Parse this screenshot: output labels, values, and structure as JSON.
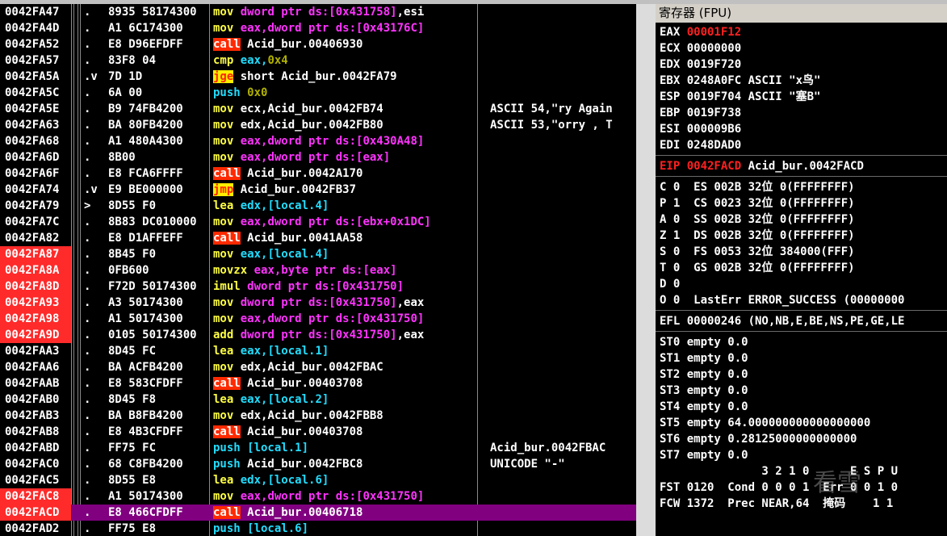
{
  "window": {
    "register_pane_title": "寄存器 (FPU)"
  },
  "disasm_rows": [
    {
      "addr": "0042FA47",
      "bp": false,
      "cur": false,
      "arrow": ".",
      "hex": "8935 58174300",
      "asm": [
        [
          "mov",
          "t-yel"
        ],
        [
          " dword ptr ds:[0x431758]",
          "t-mag"
        ],
        [
          ",esi",
          "t-white"
        ]
      ],
      "cmt": ""
    },
    {
      "addr": "0042FA4D",
      "bp": false,
      "cur": false,
      "arrow": ".",
      "hex": "A1 6C174300",
      "asm": [
        [
          "mov",
          "t-yel"
        ],
        [
          " eax,dword ptr ds:[0x43176C]",
          "t-mag"
        ]
      ],
      "cmt": ""
    },
    {
      "addr": "0042FA52",
      "bp": false,
      "cur": false,
      "arrow": ".",
      "hex": "E8 D96EFDFF",
      "asm": [
        [
          "call",
          "t-call"
        ],
        [
          " Acid_bur.00406930",
          "t-white"
        ]
      ],
      "cmt": ""
    },
    {
      "addr": "0042FA57",
      "bp": false,
      "cur": false,
      "arrow": ".",
      "hex": "83F8 04",
      "asm": [
        [
          "cmp",
          "t-yel"
        ],
        [
          " eax,",
          "t-cyan"
        ],
        [
          "0x4",
          "t-olive"
        ]
      ],
      "cmt": ""
    },
    {
      "addr": "0042FA5A",
      "bp": false,
      "cur": false,
      "arrow": ".v",
      "hex": "7D 1D",
      "asm": [
        [
          "jge",
          "t-jmp"
        ],
        [
          " short Acid_bur.0042FA79",
          "t-white"
        ]
      ],
      "cmt": ""
    },
    {
      "addr": "0042FA5C",
      "bp": false,
      "cur": false,
      "arrow": ".",
      "hex": "6A 00",
      "asm": [
        [
          "push",
          "t-cyan"
        ],
        [
          " 0x0",
          "t-olive"
        ]
      ],
      "cmt": ""
    },
    {
      "addr": "0042FA5E",
      "bp": false,
      "cur": false,
      "arrow": ".",
      "hex": "B9 74FB4200",
      "asm": [
        [
          "mov",
          "t-yel"
        ],
        [
          " ecx,Acid_bur.0042FB74",
          "t-white"
        ]
      ],
      "cmt": "ASCII 54,\"ry Again"
    },
    {
      "addr": "0042FA63",
      "bp": false,
      "cur": false,
      "arrow": ".",
      "hex": "BA 80FB4200",
      "asm": [
        [
          "mov",
          "t-yel"
        ],
        [
          " edx,Acid_bur.0042FB80",
          "t-white"
        ]
      ],
      "cmt": "ASCII 53,\"orry , T"
    },
    {
      "addr": "0042FA68",
      "bp": false,
      "cur": false,
      "arrow": ".",
      "hex": "A1 480A4300",
      "asm": [
        [
          "mov",
          "t-yel"
        ],
        [
          " eax,dword ptr ds:[0x430A48]",
          "t-mag"
        ]
      ],
      "cmt": ""
    },
    {
      "addr": "0042FA6D",
      "bp": false,
      "cur": false,
      "arrow": ".",
      "hex": "8B00",
      "asm": [
        [
          "mov",
          "t-yel"
        ],
        [
          " eax,dword ptr ds:[eax]",
          "t-mag"
        ]
      ],
      "cmt": ""
    },
    {
      "addr": "0042FA6F",
      "bp": false,
      "cur": false,
      "arrow": ".",
      "hex": "E8 FCA6FFFF",
      "asm": [
        [
          "call",
          "t-call"
        ],
        [
          " Acid_bur.0042A170",
          "t-white"
        ]
      ],
      "cmt": ""
    },
    {
      "addr": "0042FA74",
      "bp": false,
      "cur": false,
      "arrow": ".v",
      "hex": "E9 BE000000",
      "asm": [
        [
          "jmp",
          "t-jmp"
        ],
        [
          " Acid_bur.0042FB37",
          "t-white"
        ]
      ],
      "cmt": ""
    },
    {
      "addr": "0042FA79",
      "bp": false,
      "cur": false,
      "arrow": ">",
      "hex": "8D55 F0",
      "asm": [
        [
          "lea",
          "t-yel"
        ],
        [
          " edx,[local.4]",
          "t-cyan"
        ]
      ],
      "cmt": ""
    },
    {
      "addr": "0042FA7C",
      "bp": false,
      "cur": false,
      "arrow": ".",
      "hex": "8B83 DC010000",
      "asm": [
        [
          "mov",
          "t-yel"
        ],
        [
          " eax,dword ptr ds:[ebx+0x1DC]",
          "t-mag"
        ]
      ],
      "cmt": ""
    },
    {
      "addr": "0042FA82",
      "bp": false,
      "cur": false,
      "arrow": ".",
      "hex": "E8 D1AFFEFF",
      "asm": [
        [
          "call",
          "t-call"
        ],
        [
          " Acid_bur.0041AA58",
          "t-white"
        ]
      ],
      "cmt": ""
    },
    {
      "addr": "0042FA87",
      "bp": true,
      "cur": false,
      "arrow": ".",
      "hex": "8B45 F0",
      "asm": [
        [
          "mov",
          "t-yel"
        ],
        [
          " eax,[local.4]",
          "t-cyan"
        ]
      ],
      "cmt": ""
    },
    {
      "addr": "0042FA8A",
      "bp": true,
      "cur": false,
      "arrow": ".",
      "hex": "0FB600",
      "asm": [
        [
          "movzx",
          "t-yel"
        ],
        [
          " eax,byte ptr ds:[eax]",
          "t-mag"
        ]
      ],
      "cmt": ""
    },
    {
      "addr": "0042FA8D",
      "bp": true,
      "cur": false,
      "arrow": ".",
      "hex": "F72D 50174300",
      "asm": [
        [
          "imul",
          "t-yel"
        ],
        [
          " dword ptr ds:[0x431750]",
          "t-mag"
        ]
      ],
      "cmt": ""
    },
    {
      "addr": "0042FA93",
      "bp": true,
      "cur": false,
      "arrow": ".",
      "hex": "A3 50174300",
      "asm": [
        [
          "mov",
          "t-yel"
        ],
        [
          " dword ptr ds:[0x431750]",
          "t-mag"
        ],
        [
          ",eax",
          "t-white"
        ]
      ],
      "cmt": ""
    },
    {
      "addr": "0042FA98",
      "bp": true,
      "cur": false,
      "arrow": ".",
      "hex": "A1 50174300",
      "asm": [
        [
          "mov",
          "t-yel"
        ],
        [
          " eax,dword ptr ds:[0x431750]",
          "t-mag"
        ]
      ],
      "cmt": ""
    },
    {
      "addr": "0042FA9D",
      "bp": true,
      "cur": false,
      "arrow": ".",
      "hex": "0105 50174300",
      "asm": [
        [
          "add",
          "t-yel"
        ],
        [
          " dword ptr ds:[0x431750]",
          "t-mag"
        ],
        [
          ",eax",
          "t-white"
        ]
      ],
      "cmt": ""
    },
    {
      "addr": "0042FAA3",
      "bp": false,
      "cur": false,
      "arrow": ".",
      "hex": "8D45 FC",
      "asm": [
        [
          "lea",
          "t-yel"
        ],
        [
          " eax,[local.1]",
          "t-cyan"
        ]
      ],
      "cmt": ""
    },
    {
      "addr": "0042FAA6",
      "bp": false,
      "cur": false,
      "arrow": ".",
      "hex": "BA ACFB4200",
      "asm": [
        [
          "mov",
          "t-yel"
        ],
        [
          " edx,Acid_bur.0042FBAC",
          "t-white"
        ]
      ],
      "cmt": ""
    },
    {
      "addr": "0042FAAB",
      "bp": false,
      "cur": false,
      "arrow": ".",
      "hex": "E8 583CFDFF",
      "asm": [
        [
          "call",
          "t-call"
        ],
        [
          " Acid_bur.00403708",
          "t-white"
        ]
      ],
      "cmt": ""
    },
    {
      "addr": "0042FAB0",
      "bp": false,
      "cur": false,
      "arrow": ".",
      "hex": "8D45 F8",
      "asm": [
        [
          "lea",
          "t-yel"
        ],
        [
          " eax,[local.2]",
          "t-cyan"
        ]
      ],
      "cmt": ""
    },
    {
      "addr": "0042FAB3",
      "bp": false,
      "cur": false,
      "arrow": ".",
      "hex": "BA B8FB4200",
      "asm": [
        [
          "mov",
          "t-yel"
        ],
        [
          " edx,Acid_bur.0042FBB8",
          "t-white"
        ]
      ],
      "cmt": ""
    },
    {
      "addr": "0042FAB8",
      "bp": false,
      "cur": false,
      "arrow": ".",
      "hex": "E8 4B3CFDFF",
      "asm": [
        [
          "call",
          "t-call"
        ],
        [
          " Acid_bur.00403708",
          "t-white"
        ]
      ],
      "cmt": ""
    },
    {
      "addr": "0042FABD",
      "bp": false,
      "cur": false,
      "arrow": ".",
      "hex": "FF75 FC",
      "asm": [
        [
          "push",
          "t-cyan"
        ],
        [
          " [local.1]",
          "t-cyan"
        ]
      ],
      "cmt": "Acid_bur.0042FBAC"
    },
    {
      "addr": "0042FAC0",
      "bp": false,
      "cur": false,
      "arrow": ".",
      "hex": "68 C8FB4200",
      "asm": [
        [
          "push",
          "t-cyan"
        ],
        [
          " Acid_bur.0042FBC8",
          "t-white"
        ]
      ],
      "cmt": "UNICODE \"-\""
    },
    {
      "addr": "0042FAC5",
      "bp": false,
      "cur": false,
      "arrow": ".",
      "hex": "8D55 E8",
      "asm": [
        [
          "lea",
          "t-yel"
        ],
        [
          " edx,[local.6]",
          "t-cyan"
        ]
      ],
      "cmt": ""
    },
    {
      "addr": "0042FAC8",
      "bp": true,
      "cur": false,
      "arrow": ".",
      "hex": "A1 50174300",
      "asm": [
        [
          "mov",
          "t-yel"
        ],
        [
          " eax,dword ptr ds:[0x431750]",
          "t-mag"
        ]
      ],
      "cmt": ""
    },
    {
      "addr": "0042FACD",
      "bp": true,
      "cur": true,
      "arrow": ".",
      "hex": "E8 466CFDFF",
      "asm": [
        [
          "call",
          "t-call"
        ],
        [
          " Acid_bur.00406718",
          "t-white"
        ]
      ],
      "cmt": ""
    },
    {
      "addr": "0042FAD2",
      "bp": false,
      "cur": false,
      "arrow": ".",
      "hex": "FF75 E8",
      "asm": [
        [
          "push",
          "t-cyan"
        ],
        [
          " [local.6]",
          "t-cyan"
        ]
      ],
      "cmt": ""
    }
  ],
  "registers": {
    "lines": [
      {
        "key": "EAX",
        "text": [
          [
            "EAX ",
            "t-white"
          ],
          [
            "00001F12",
            "r-red"
          ]
        ]
      },
      {
        "key": "ECX",
        "text": [
          [
            "ECX 00000000",
            "t-white"
          ]
        ]
      },
      {
        "key": "EDX",
        "text": [
          [
            "EDX 0019F720",
            "t-white"
          ]
        ]
      },
      {
        "key": "EBX",
        "text": [
          [
            "EBX 0248A0FC ASCII \"x鸟\"",
            "t-white"
          ]
        ]
      },
      {
        "key": "ESP",
        "text": [
          [
            "ESP 0019F704 ASCII \"塞B\"",
            "t-white"
          ]
        ]
      },
      {
        "key": "EBP",
        "text": [
          [
            "EBP 0019F738",
            "t-white"
          ]
        ]
      },
      {
        "key": "ESI",
        "text": [
          [
            "ESI 000009B6",
            "t-white"
          ]
        ]
      },
      {
        "key": "EDI",
        "text": [
          [
            "EDI 0248DAD0",
            "t-white"
          ]
        ]
      }
    ],
    "eip": [
      [
        "EIP ",
        "r-red"
      ],
      [
        "0042FACD",
        "r-red"
      ],
      [
        " Acid_bur.0042FACD",
        "t-white"
      ]
    ],
    "flags": [
      "C 0  ES 002B 32位 0(FFFFFFFF)",
      "P 1  CS 0023 32位 0(FFFFFFFF)",
      "A 0  SS 002B 32位 0(FFFFFFFF)",
      "Z 1  DS 002B 32位 0(FFFFFFFF)",
      "S 0  FS 0053 32位 384000(FFF)",
      "T 0  GS 002B 32位 0(FFFFFFFF)",
      "D 0",
      "O 0  LastErr ERROR_SUCCESS (00000000"
    ],
    "efl": "EFL 00000246 (NO,NB,E,BE,NS,PE,GE,LE",
    "fpu": [
      "ST0 empty 0.0",
      "ST1 empty 0.0",
      "ST2 empty 0.0",
      "ST3 empty 0.0",
      "ST4 empty 0.0",
      "ST5 empty 64.000000000000000000",
      "ST6 empty 0.28125000000000000",
      "ST7 empty 0.0"
    ],
    "fpu_bits_header": "               3 2 1 0      E S P U",
    "fst": "FST 0120  Cond 0 0 0 1  Err 0 0 1 0",
    "fcw": "FCW 1372  Prec NEAR,64  掩码    1 1"
  },
  "watermark": {
    "text": "看雪",
    "sub": "掩码"
  }
}
